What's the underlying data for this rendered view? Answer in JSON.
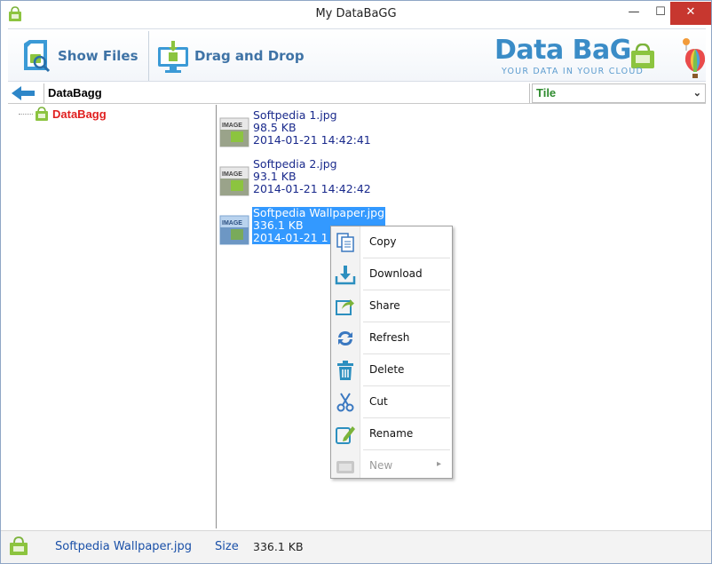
{
  "window": {
    "title": "My DataBaGG",
    "minimize": "—",
    "maximize": "☐",
    "close": "✕"
  },
  "toolbar": {
    "show_files": "Show Files",
    "drag_drop": "Drag and Drop",
    "logo_main": "Data BaG",
    "logo_sub": "YOUR DATA IN YOUR CLOUD"
  },
  "addressbar": {
    "path": "DataBagg",
    "view_mode": "Tile"
  },
  "tree": {
    "root_label": "DataBagg"
  },
  "files": [
    {
      "name": "Softpedia 1.jpg",
      "size": "98.5 KB",
      "date": "2014-01-21 14:42:41",
      "thumb_label": "IMAGE"
    },
    {
      "name": "Softpedia 2.jpg",
      "size": "93.1 KB",
      "date": "2014-01-21 14:42:42",
      "thumb_label": "IMAGE"
    },
    {
      "name": "Softpedia Wallpaper.jpg",
      "size": "336.1 KB",
      "date": "2014-01-21 1",
      "thumb_label": "IMAGE"
    }
  ],
  "context_menu": [
    {
      "label": "Copy",
      "icon": "copy-icon"
    },
    {
      "label": "Download",
      "icon": "download-icon"
    },
    {
      "label": "Share",
      "icon": "share-icon"
    },
    {
      "label": "Refresh",
      "icon": "refresh-icon"
    },
    {
      "label": "Delete",
      "icon": "trash-icon"
    },
    {
      "label": "Cut",
      "icon": "scissors-icon"
    },
    {
      "label": "Rename",
      "icon": "rename-icon"
    },
    {
      "label": "New",
      "icon": "new-icon",
      "disabled": true
    }
  ],
  "statusbar": {
    "file_name": "Softpedia Wallpaper.jpg",
    "size_label": "Size",
    "size_value": "336.1 KB"
  },
  "colors": {
    "accent": "#3a8cc7",
    "selection": "#3399ff",
    "tree_label": "#e02020",
    "view_mode": "#2e8b2e",
    "file_text": "#1a2a8c"
  }
}
